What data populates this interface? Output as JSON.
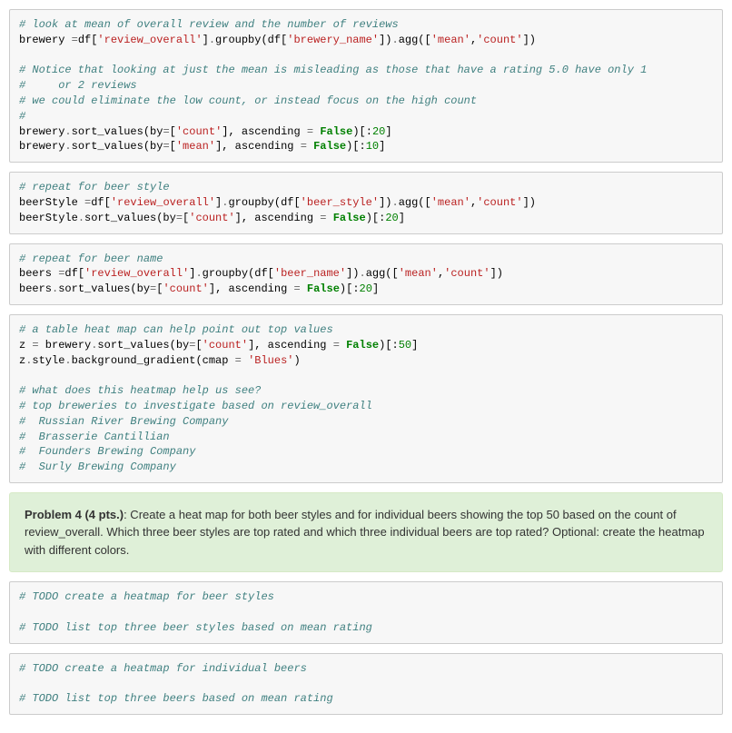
{
  "cells": [
    {
      "type": "code",
      "tokens": [
        {
          "t": "# look at mean of overall review and the number of reviews",
          "c": "c-comment"
        },
        {
          "t": "\n",
          "c": ""
        },
        {
          "t": "brewery ",
          "c": "c-name"
        },
        {
          "t": "=",
          "c": "c-op"
        },
        {
          "t": "df[",
          "c": "c-name"
        },
        {
          "t": "'review_overall'",
          "c": "c-string"
        },
        {
          "t": "]",
          "c": "c-name"
        },
        {
          "t": ".",
          "c": "c-op"
        },
        {
          "t": "groupby(df[",
          "c": "c-name"
        },
        {
          "t": "'brewery_name'",
          "c": "c-string"
        },
        {
          "t": "])",
          "c": "c-name"
        },
        {
          "t": ".",
          "c": "c-op"
        },
        {
          "t": "agg([",
          "c": "c-name"
        },
        {
          "t": "'mean'",
          "c": "c-string"
        },
        {
          "t": ",",
          "c": "c-name"
        },
        {
          "t": "'count'",
          "c": "c-string"
        },
        {
          "t": "])",
          "c": "c-name"
        },
        {
          "t": "\n\n",
          "c": ""
        },
        {
          "t": "# Notice that looking at just the mean is misleading as those that have a rating 5.0 have only 1",
          "c": "c-comment"
        },
        {
          "t": "\n",
          "c": ""
        },
        {
          "t": "#     or 2 reviews",
          "c": "c-comment"
        },
        {
          "t": "\n",
          "c": ""
        },
        {
          "t": "# we could eliminate the low count, or instead focus on the high count",
          "c": "c-comment"
        },
        {
          "t": "\n",
          "c": ""
        },
        {
          "t": "#",
          "c": "c-comment"
        },
        {
          "t": "\n",
          "c": ""
        },
        {
          "t": "brewery",
          "c": "c-name"
        },
        {
          "t": ".",
          "c": "c-op"
        },
        {
          "t": "sort_values(by",
          "c": "c-name"
        },
        {
          "t": "=",
          "c": "c-op"
        },
        {
          "t": "[",
          "c": "c-name"
        },
        {
          "t": "'count'",
          "c": "c-string"
        },
        {
          "t": "], ascending ",
          "c": "c-name"
        },
        {
          "t": "=",
          "c": "c-op"
        },
        {
          "t": " ",
          "c": ""
        },
        {
          "t": "False",
          "c": "c-keyword"
        },
        {
          "t": ")[:",
          "c": "c-name"
        },
        {
          "t": "20",
          "c": "c-num"
        },
        {
          "t": "]",
          "c": "c-name"
        },
        {
          "t": "\n",
          "c": ""
        },
        {
          "t": "brewery",
          "c": "c-name"
        },
        {
          "t": ".",
          "c": "c-op"
        },
        {
          "t": "sort_values(by",
          "c": "c-name"
        },
        {
          "t": "=",
          "c": "c-op"
        },
        {
          "t": "[",
          "c": "c-name"
        },
        {
          "t": "'mean'",
          "c": "c-string"
        },
        {
          "t": "], ascending ",
          "c": "c-name"
        },
        {
          "t": "=",
          "c": "c-op"
        },
        {
          "t": " ",
          "c": ""
        },
        {
          "t": "False",
          "c": "c-keyword"
        },
        {
          "t": ")[:",
          "c": "c-name"
        },
        {
          "t": "10",
          "c": "c-num"
        },
        {
          "t": "]",
          "c": "c-name"
        }
      ]
    },
    {
      "type": "code",
      "tokens": [
        {
          "t": "# repeat for beer style",
          "c": "c-comment"
        },
        {
          "t": "\n",
          "c": ""
        },
        {
          "t": "beerStyle ",
          "c": "c-name"
        },
        {
          "t": "=",
          "c": "c-op"
        },
        {
          "t": "df[",
          "c": "c-name"
        },
        {
          "t": "'review_overall'",
          "c": "c-string"
        },
        {
          "t": "]",
          "c": "c-name"
        },
        {
          "t": ".",
          "c": "c-op"
        },
        {
          "t": "groupby(df[",
          "c": "c-name"
        },
        {
          "t": "'beer_style'",
          "c": "c-string"
        },
        {
          "t": "])",
          "c": "c-name"
        },
        {
          "t": ".",
          "c": "c-op"
        },
        {
          "t": "agg([",
          "c": "c-name"
        },
        {
          "t": "'mean'",
          "c": "c-string"
        },
        {
          "t": ",",
          "c": "c-name"
        },
        {
          "t": "'count'",
          "c": "c-string"
        },
        {
          "t": "])",
          "c": "c-name"
        },
        {
          "t": "\n",
          "c": ""
        },
        {
          "t": "beerStyle",
          "c": "c-name"
        },
        {
          "t": ".",
          "c": "c-op"
        },
        {
          "t": "sort_values(by",
          "c": "c-name"
        },
        {
          "t": "=",
          "c": "c-op"
        },
        {
          "t": "[",
          "c": "c-name"
        },
        {
          "t": "'count'",
          "c": "c-string"
        },
        {
          "t": "], ascending ",
          "c": "c-name"
        },
        {
          "t": "=",
          "c": "c-op"
        },
        {
          "t": " ",
          "c": ""
        },
        {
          "t": "False",
          "c": "c-keyword"
        },
        {
          "t": ")[:",
          "c": "c-name"
        },
        {
          "t": "20",
          "c": "c-num"
        },
        {
          "t": "]",
          "c": "c-name"
        }
      ]
    },
    {
      "type": "code",
      "tokens": [
        {
          "t": "# repeat for beer name",
          "c": "c-comment"
        },
        {
          "t": "\n",
          "c": ""
        },
        {
          "t": "beers ",
          "c": "c-name"
        },
        {
          "t": "=",
          "c": "c-op"
        },
        {
          "t": "df[",
          "c": "c-name"
        },
        {
          "t": "'review_overall'",
          "c": "c-string"
        },
        {
          "t": "]",
          "c": "c-name"
        },
        {
          "t": ".",
          "c": "c-op"
        },
        {
          "t": "groupby(df[",
          "c": "c-name"
        },
        {
          "t": "'beer_name'",
          "c": "c-string"
        },
        {
          "t": "])",
          "c": "c-name"
        },
        {
          "t": ".",
          "c": "c-op"
        },
        {
          "t": "agg([",
          "c": "c-name"
        },
        {
          "t": "'mean'",
          "c": "c-string"
        },
        {
          "t": ",",
          "c": "c-name"
        },
        {
          "t": "'count'",
          "c": "c-string"
        },
        {
          "t": "])",
          "c": "c-name"
        },
        {
          "t": "\n",
          "c": ""
        },
        {
          "t": "beers",
          "c": "c-name"
        },
        {
          "t": ".",
          "c": "c-op"
        },
        {
          "t": "sort_values(by",
          "c": "c-name"
        },
        {
          "t": "=",
          "c": "c-op"
        },
        {
          "t": "[",
          "c": "c-name"
        },
        {
          "t": "'count'",
          "c": "c-string"
        },
        {
          "t": "], ascending ",
          "c": "c-name"
        },
        {
          "t": "=",
          "c": "c-op"
        },
        {
          "t": " ",
          "c": ""
        },
        {
          "t": "False",
          "c": "c-keyword"
        },
        {
          "t": ")[:",
          "c": "c-name"
        },
        {
          "t": "20",
          "c": "c-num"
        },
        {
          "t": "]",
          "c": "c-name"
        }
      ]
    },
    {
      "type": "code",
      "tokens": [
        {
          "t": "# a table heat map can help point out top values",
          "c": "c-comment"
        },
        {
          "t": "\n",
          "c": ""
        },
        {
          "t": "z ",
          "c": "c-name"
        },
        {
          "t": "=",
          "c": "c-op"
        },
        {
          "t": " brewery",
          "c": "c-name"
        },
        {
          "t": ".",
          "c": "c-op"
        },
        {
          "t": "sort_values(by",
          "c": "c-name"
        },
        {
          "t": "=",
          "c": "c-op"
        },
        {
          "t": "[",
          "c": "c-name"
        },
        {
          "t": "'count'",
          "c": "c-string"
        },
        {
          "t": "], ascending ",
          "c": "c-name"
        },
        {
          "t": "=",
          "c": "c-op"
        },
        {
          "t": " ",
          "c": ""
        },
        {
          "t": "False",
          "c": "c-keyword"
        },
        {
          "t": ")[:",
          "c": "c-name"
        },
        {
          "t": "50",
          "c": "c-num"
        },
        {
          "t": "]",
          "c": "c-name"
        },
        {
          "t": "\n",
          "c": ""
        },
        {
          "t": "z",
          "c": "c-name"
        },
        {
          "t": ".",
          "c": "c-op"
        },
        {
          "t": "style",
          "c": "c-name"
        },
        {
          "t": ".",
          "c": "c-op"
        },
        {
          "t": "background_gradient(cmap ",
          "c": "c-name"
        },
        {
          "t": "=",
          "c": "c-op"
        },
        {
          "t": " ",
          "c": ""
        },
        {
          "t": "'Blues'",
          "c": "c-string"
        },
        {
          "t": ")",
          "c": "c-name"
        },
        {
          "t": "\n\n",
          "c": ""
        },
        {
          "t": "# what does this heatmap help us see?",
          "c": "c-comment"
        },
        {
          "t": "\n",
          "c": ""
        },
        {
          "t": "# top breweries to investigate based on review_overall",
          "c": "c-comment"
        },
        {
          "t": "\n",
          "c": ""
        },
        {
          "t": "#  Russian River Brewing Company",
          "c": "c-comment"
        },
        {
          "t": "\n",
          "c": ""
        },
        {
          "t": "#  Brasserie Cantillian",
          "c": "c-comment"
        },
        {
          "t": "\n",
          "c": ""
        },
        {
          "t": "#  Founders Brewing Company",
          "c": "c-comment"
        },
        {
          "t": "\n",
          "c": ""
        },
        {
          "t": "#  Surly Brewing Company",
          "c": "c-comment"
        }
      ]
    },
    {
      "type": "markdown",
      "bold": "Problem 4 (4 pts.)",
      "text": ": Create a heat map for both beer styles and for individual beers showing the top 50 based on the count of review_overall. Which three beer styles are top rated and which three individual beers are top rated? Optional: create the heatmap with different colors."
    },
    {
      "type": "code",
      "tokens": [
        {
          "t": "# TODO create a heatmap for beer styles",
          "c": "c-comment"
        },
        {
          "t": "\n\n",
          "c": ""
        },
        {
          "t": "# TODO list top three beer styles based on mean rating",
          "c": "c-comment"
        }
      ]
    },
    {
      "type": "code",
      "tokens": [
        {
          "t": "# TODO create a heatmap for individual beers",
          "c": "c-comment"
        },
        {
          "t": "\n\n",
          "c": ""
        },
        {
          "t": "# TODO list top three beers based on mean rating",
          "c": "c-comment"
        }
      ]
    }
  ]
}
